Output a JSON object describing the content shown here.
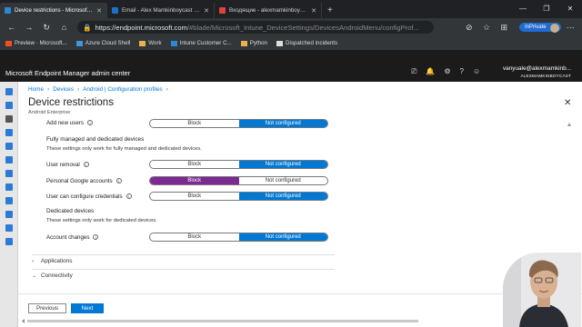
{
  "browser": {
    "tabs": [
      {
        "title": "Device restrictions - Microsoft E",
        "active": true,
        "icon_color": "#2b88d8"
      },
      {
        "title": "Email - Alex Mamkinboycast - O",
        "active": false,
        "icon_color": "#1e6fc7"
      },
      {
        "title": "Входящие - alexmamkinboycas",
        "active": false,
        "icon_color": "#d8453a"
      }
    ],
    "new_tab": "+",
    "url_host": "https://endpoint.microsoft.com",
    "url_path": "/#blade/Microsoft_Intune_DeviceSettings/DevicesAndroidMenu/configProf...",
    "inprivate_label": "InPrivate",
    "bookmarks": [
      {
        "label": "Preview · Microsoft...",
        "icon": "ms-icon"
      },
      {
        "label": "Azure Cloud Shell",
        "icon": "azure-icon"
      },
      {
        "label": "Work",
        "icon": "folder-icon"
      },
      {
        "label": "Intune Customer C...",
        "icon": "intune-icon"
      },
      {
        "label": "Python",
        "icon": "folder-icon"
      },
      {
        "label": "Dispatched incidents",
        "icon": "page-icon"
      }
    ]
  },
  "portal": {
    "app_title": "Microsoft Endpoint Manager admin center",
    "user_email": "vanyuale@alexmamkinb...",
    "user_org": "ALEXMAMKINBOYCAST"
  },
  "breadcrumb": {
    "home": "Home",
    "devices": "Devices",
    "config": "Android | Configuration profiles"
  },
  "page": {
    "title": "Device restrictions",
    "subtitle": "Android Enterprise"
  },
  "settings": {
    "add_new_users": {
      "label": "Add new users",
      "left": "Block",
      "right": "Not configured",
      "selected": "right"
    },
    "fully_managed_heading": "Fully managed and dedicated devices",
    "fully_managed_desc": "These settings only work for fully managed and dedicated devices.",
    "user_removal": {
      "label": "User removal",
      "left": "Block",
      "right": "Not configured",
      "selected": "right"
    },
    "personal_google": {
      "label": "Personal Google accounts",
      "left": "Block",
      "right": "Not configured",
      "selected": "left"
    },
    "configure_credentials": {
      "label": "User can configure credentials",
      "left": "Block",
      "right": "Not configured",
      "selected": "right"
    },
    "dedicated_heading": "Dedicated devices",
    "dedicated_desc": "These settings only work for dedicated devices.",
    "account_changes": {
      "label": "Account changes",
      "left": "Block",
      "right": "Not configured",
      "selected": "right"
    }
  },
  "sections": {
    "applications": "Applications",
    "connectivity": "Connectivity"
  },
  "footer": {
    "previous": "Previous",
    "next": "Next"
  },
  "colors": {
    "accent": "#0078d4",
    "block_selected": "#7b2a91",
    "header_bg": "#1b1b1b"
  }
}
